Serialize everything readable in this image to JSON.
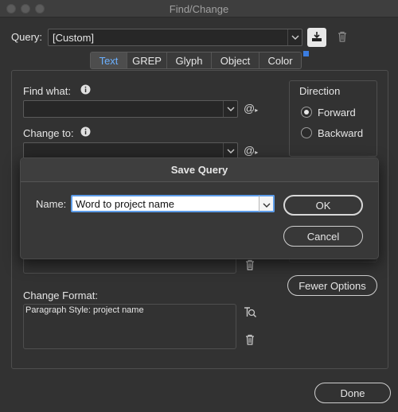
{
  "window": {
    "title": "Find/Change"
  },
  "query": {
    "label": "Query:",
    "value": "[Custom]"
  },
  "tabs": [
    {
      "label": "Text",
      "active": true
    },
    {
      "label": "GREP",
      "active": false
    },
    {
      "label": "Glyph",
      "active": false
    },
    {
      "label": "Object",
      "active": false
    },
    {
      "label": "Color",
      "active": false
    }
  ],
  "find_what": {
    "label": "Find what:",
    "value": ""
  },
  "change_to": {
    "label": "Change to:",
    "value": ""
  },
  "direction": {
    "label": "Direction",
    "forward": "Forward",
    "backward": "Backward",
    "selected": "Forward"
  },
  "fewer_options": "Fewer Options",
  "change_format": {
    "label": "Change Format:",
    "value": "Paragraph Style: project name"
  },
  "done": "Done",
  "save_query": {
    "title": "Save Query",
    "name_label": "Name:",
    "name_value": "Word to project name",
    "ok": "OK",
    "cancel": "Cancel"
  },
  "colors": {
    "accent": "#5d9ce8",
    "active_tab_text": "#6bb0ff",
    "background": "#323232"
  }
}
